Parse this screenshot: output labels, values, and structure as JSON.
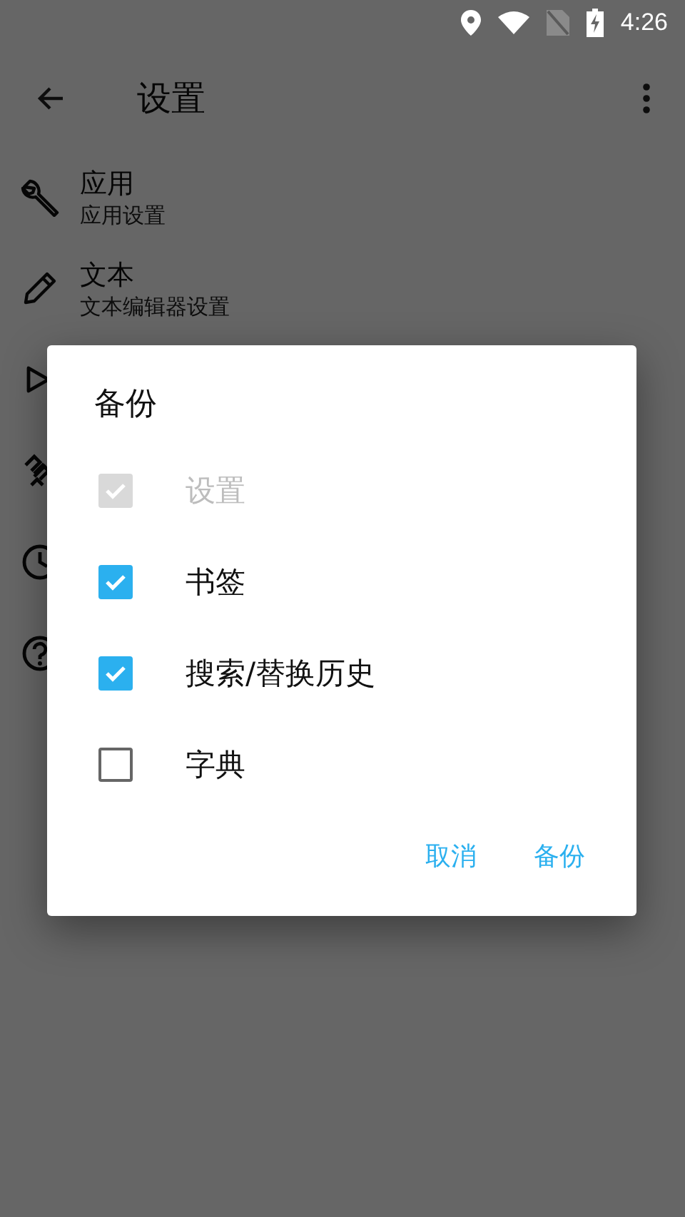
{
  "status_bar": {
    "time": "4:26"
  },
  "app_bar": {
    "title": "设置"
  },
  "settings": [
    {
      "title": "应用",
      "subtitle": "应用设置"
    },
    {
      "title": "文本",
      "subtitle": "文本编辑器设置"
    }
  ],
  "dialog": {
    "title": "备份",
    "options": [
      {
        "label": "设置",
        "checked": true,
        "disabled": true
      },
      {
        "label": "书签",
        "checked": true,
        "disabled": false
      },
      {
        "label": "搜索/替换历史",
        "checked": true,
        "disabled": false
      },
      {
        "label": "字典",
        "checked": false,
        "disabled": false
      }
    ],
    "buttons": [
      "取消",
      "备份"
    ]
  }
}
